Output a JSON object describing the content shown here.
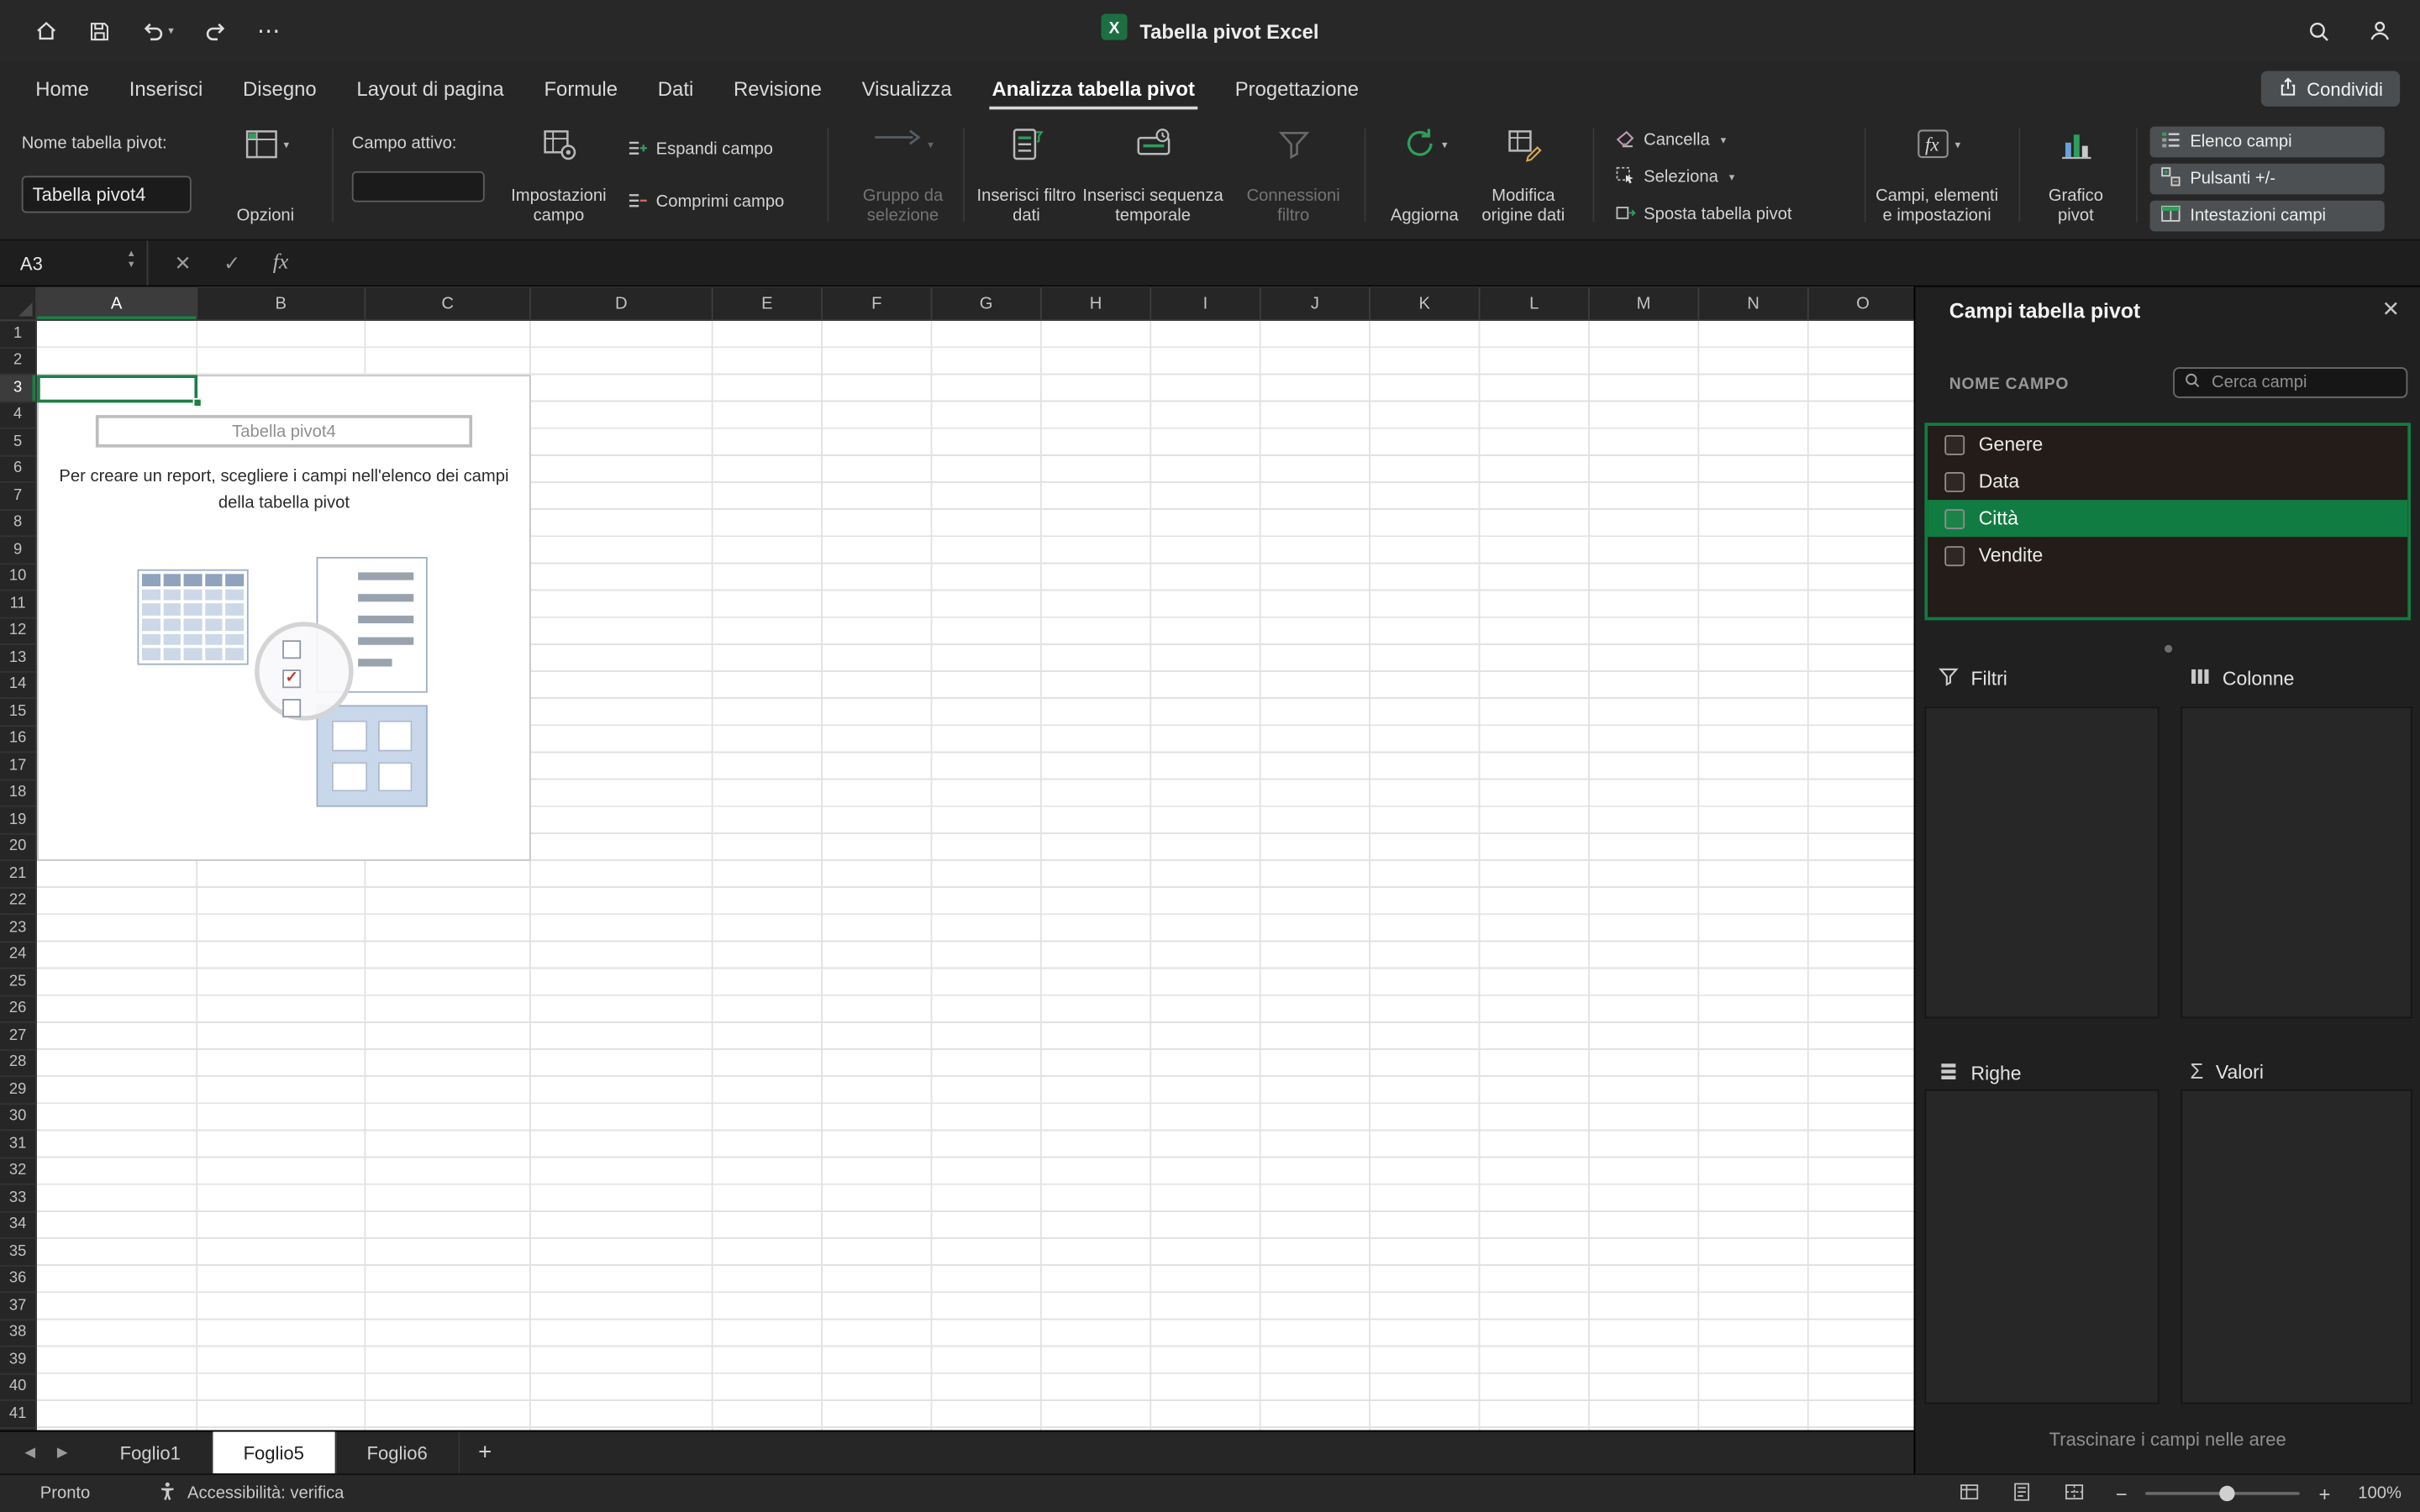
{
  "colors": {
    "accent_green": "#107C41",
    "selection_green": "#1E7E45",
    "active_sheet_tab_bg": "#FFFFFF"
  },
  "titlebar": {
    "title": "Tabella pivot Excel"
  },
  "tabs": [
    "Home",
    "Inserisci",
    "Disegno",
    "Layout di pagina",
    "Formule",
    "Dati",
    "Revisione",
    "Visualizza",
    "Analizza tabella pivot",
    "Progettazione"
  ],
  "active_tab": "Analizza tabella pivot",
  "share": {
    "label": "Condividi"
  },
  "ribbon": {
    "pivot_name_label": "Nome tabella pivot:",
    "pivot_name_value": "Tabella pivot4",
    "options": "Opzioni",
    "active_field_label": "Campo attivo:",
    "active_field_value": "",
    "field_settings": "Impostazioni campo",
    "expand_field": "Espandi campo",
    "collapse_field": "Comprimi campo",
    "group_selection": "Gruppo da selezione",
    "insert_slicer": "Inserisci filtro dati",
    "insert_timeline": "Inserisci sequenza temporale",
    "filter_connections": "Connessioni filtro",
    "refresh": "Aggiorna",
    "change_source": "Modifica origine dati",
    "clear": "Cancella",
    "select": "Seleziona",
    "move_pivot": "Sposta tabella pivot",
    "fields_items": "Campi, elementi e impostazioni",
    "pivot_chart": "Grafico pivot",
    "toggles": [
      "Elenco campi",
      "Pulsanti +/-",
      "Intestazioni campi"
    ]
  },
  "formula_bar": {
    "name_box": "A3",
    "value": ""
  },
  "grid": {
    "columns": [
      "A",
      "B",
      "C",
      "D",
      "E",
      "F",
      "G",
      "H",
      "I",
      "J",
      "K",
      "L",
      "M",
      "N",
      "O"
    ],
    "row_count": 41,
    "selected_cell": "A3",
    "selected_column": "A",
    "selected_row": 3
  },
  "pivot_placeholder": {
    "name": "Tabella pivot4",
    "instructions": "Per creare un report, scegliere i campi nell'elenco dei campi della tabella pivot"
  },
  "sheet_tabs": {
    "tabs": [
      "Foglio1",
      "Foglio5",
      "Foglio6"
    ],
    "active": "Foglio5",
    "add_label": "+"
  },
  "status_bar": {
    "mode": "Pronto",
    "accessibility": "Accessibilità: verifica",
    "zoom": "100%"
  },
  "fields_panel": {
    "title": "Campi tabella pivot",
    "field_name_label": "NOME CAMPO",
    "search_placeholder": "Cerca campi",
    "fields": [
      {
        "name": "Genere",
        "checked": false,
        "selected": false
      },
      {
        "name": "Data",
        "checked": false,
        "selected": false
      },
      {
        "name": "Città",
        "checked": false,
        "selected": true
      },
      {
        "name": "Vendite",
        "checked": false,
        "selected": false
      }
    ],
    "areas": [
      {
        "label": "Filtri",
        "icon": "filter-icon"
      },
      {
        "label": "Colonne",
        "icon": "columns-icon"
      },
      {
        "label": "Righe",
        "icon": "rows-icon"
      },
      {
        "label": "Valori",
        "icon": "sigma-icon"
      }
    ],
    "hint": "Trascinare i campi nelle aree"
  }
}
